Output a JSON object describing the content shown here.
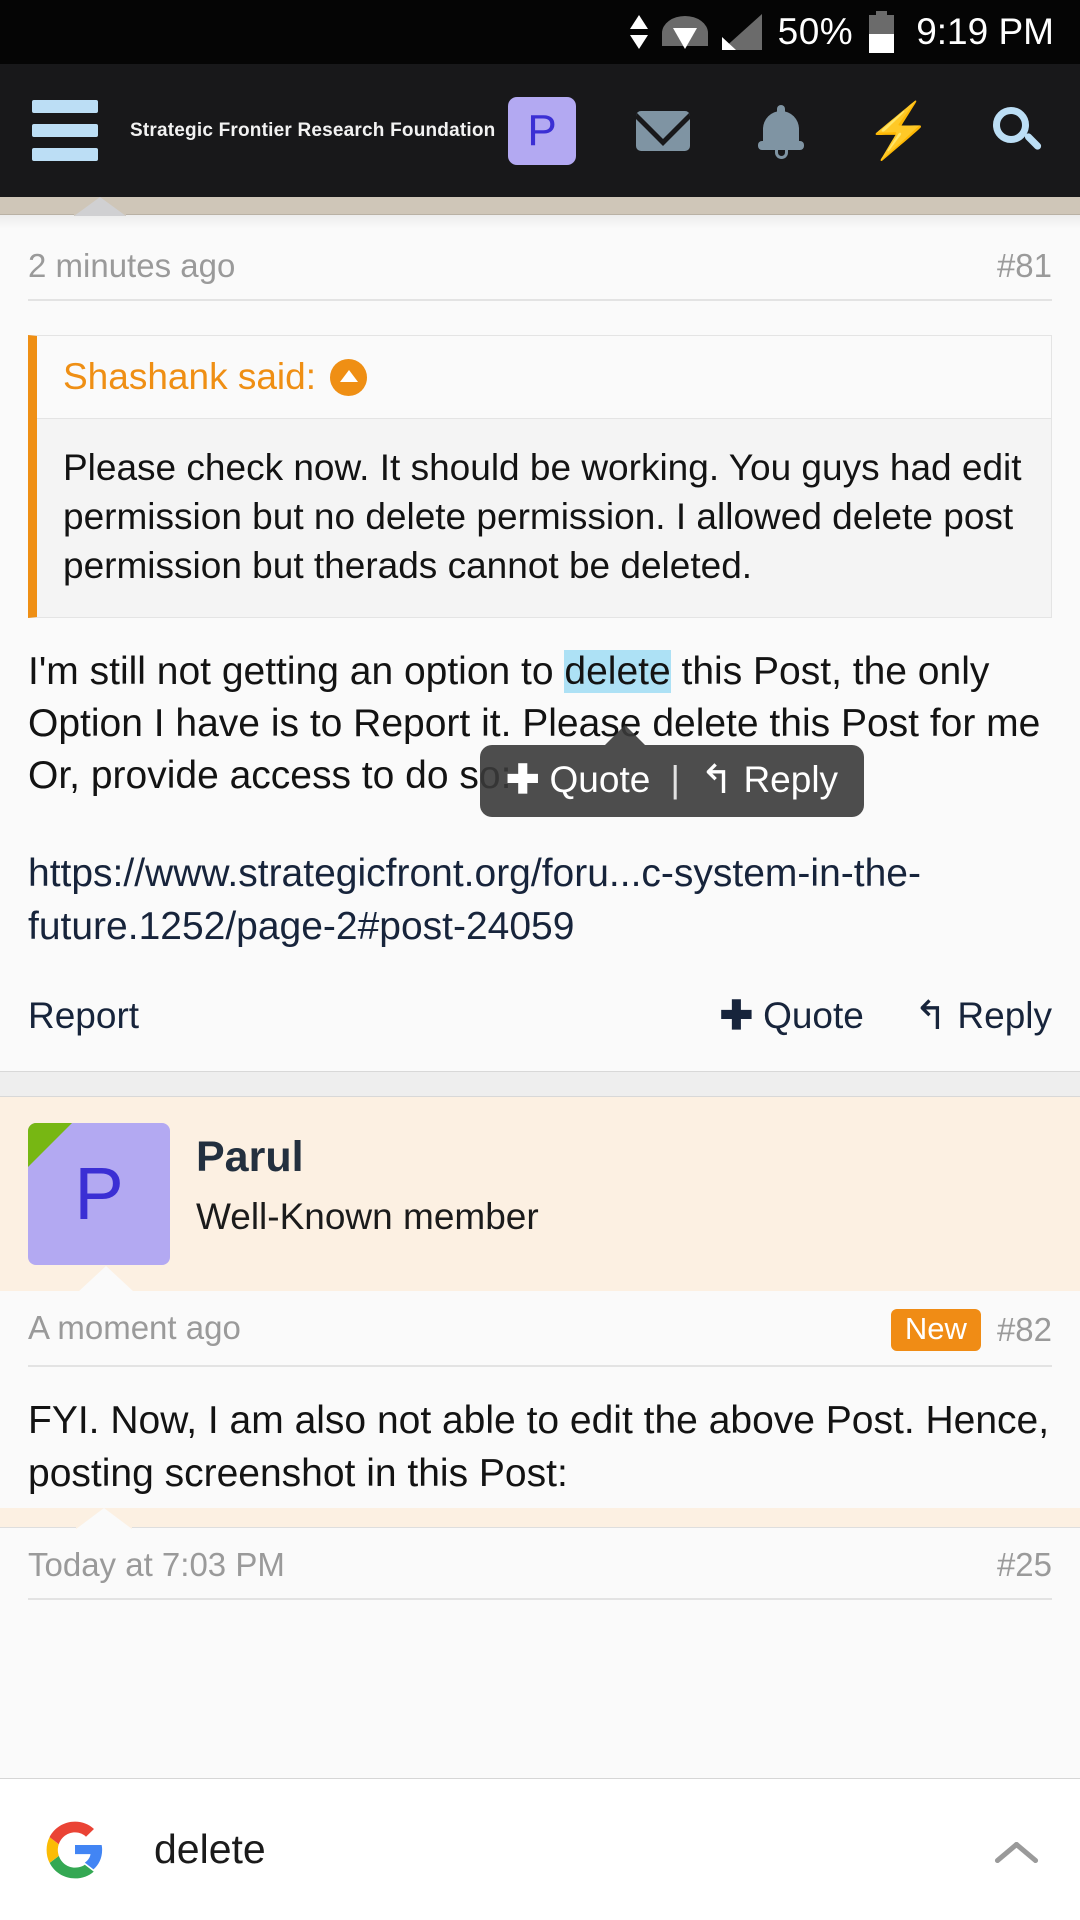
{
  "status_bar": {
    "battery_percent": "50%",
    "time": "9:19 PM",
    "icons": [
      "data-transfer-icon",
      "wifi-icon",
      "cellular-signal-icon",
      "battery-icon"
    ]
  },
  "app_bar": {
    "menu_icon": "hamburger-menu-icon",
    "site_title": "Strategic Frontier Research Foundation",
    "account_initial": "P",
    "icons": [
      "inbox-icon",
      "alerts-bell-icon",
      "whats-new-bolt-icon",
      "search-icon"
    ]
  },
  "post_81": {
    "date": "2 minutes ago",
    "number": "#81",
    "quote": {
      "author_line": "Shashank said:",
      "jump_icon": "jump-to-post-icon",
      "body": "Please check now. It should be working. You guys had edit permission but no delete permission. I allowed delete post permission but therads cannot be deleted."
    },
    "text_before_highlight": "I'm still not getting an option to ",
    "highlighted_word": "delete",
    "text_after_highlight": " this Post, the only Option I have is to Report it. Please delete this Post for me Or, provide access to do so:",
    "url": "https://www.strategicfront.org/foru...c-system-in-the-future.1252/page-2#post-24059",
    "actions": {
      "report": "Report",
      "quote": "Quote",
      "reply": "Reply"
    }
  },
  "selection_tooltip": {
    "quote": "Quote",
    "separator": "|",
    "reply": "Reply",
    "plus_icon": "plus-icon",
    "reply_icon": "reply-arrow-icon"
  },
  "post_82": {
    "author": {
      "avatar_initial": "P",
      "name": "Parul",
      "user_title": "Well-Known member"
    },
    "date": "A moment ago",
    "badge": "New",
    "number": "#82",
    "text": "FYI. Now, I am also not able to edit the above Post. Hence, posting screenshot in this Post:"
  },
  "inner_quoted_post": {
    "date": "Today at 7:03 PM",
    "number": "#25"
  },
  "google_bar": {
    "logo_icon": "google-g-icon",
    "query": "delete",
    "collapse_icon": "chevron-up-icon"
  },
  "colors": {
    "accent_orange": "#ef8f14",
    "badge_orange": "#f08c15",
    "avatar_purple": "#b3a9f2",
    "avatar_letter": "#3b2fd4",
    "highlight_blue": "#ade1f5",
    "link_navy": "#17243b",
    "header_dark": "#18181a",
    "status_black": "#050505",
    "icon_slate": "#7f94a3",
    "icon_light_blue": "#bcdef5",
    "user_block_cream": "#fcf0e2",
    "online_green": "#77b713"
  }
}
